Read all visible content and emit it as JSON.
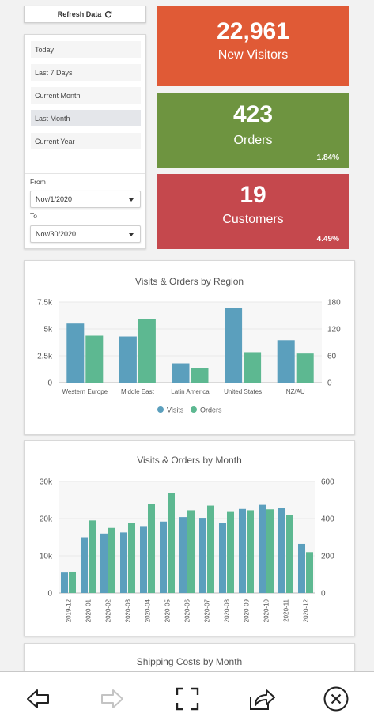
{
  "refresh": {
    "label": "Refresh Data",
    "icon": "refresh-icon"
  },
  "date_ranges": [
    "Today",
    "Last 7 Days",
    "Current Month",
    "Last Month",
    "Current Year"
  ],
  "date_range_selected": "Last Month",
  "from": {
    "label": "From",
    "value": "Nov/1/2020"
  },
  "to": {
    "label": "To",
    "value": "Nov/30/2020"
  },
  "kpis": [
    {
      "value": "22,961",
      "label": "New Visitors",
      "percent": "",
      "color": "#e05a36"
    },
    {
      "value": "423",
      "label": "Orders",
      "percent": "1.84%",
      "color": "#6e9440"
    },
    {
      "value": "19",
      "label": "Customers",
      "percent": "4.49%",
      "color": "#c5484d"
    }
  ],
  "colors": {
    "visits": "#5b9fbd",
    "orders": "#5db891"
  },
  "chart_data": [
    {
      "type": "bar",
      "title": "Visits & Orders by Region",
      "categories": [
        "Western Europe",
        "Middle East",
        "Latin America",
        "United States",
        "NZ/AU"
      ],
      "series": [
        {
          "name": "Visits",
          "axis": "left",
          "values": [
            5500,
            4300,
            1800,
            6950,
            3950
          ]
        },
        {
          "name": "Orders",
          "axis": "right",
          "values": [
            105,
            142,
            33,
            68,
            65
          ]
        }
      ],
      "ylim_left": [
        0,
        7500
      ],
      "yticks_left": [
        "0",
        "2.5k",
        "5k",
        "7.5k"
      ],
      "ylim_right": [
        0,
        180
      ],
      "yticks_right": [
        "0",
        "60",
        "120",
        "180"
      ],
      "legend": "bottom",
      "grid": true
    },
    {
      "type": "bar",
      "title": "Visits & Orders by Month",
      "categories": [
        "2019-12",
        "2020-01",
        "2020-02",
        "2020-03",
        "2020-04",
        "2020-05",
        "2020-06",
        "2020-07",
        "2020-08",
        "2020-09",
        "2020-10",
        "2020-11",
        "2020-12"
      ],
      "series": [
        {
          "name": "Visits",
          "axis": "left",
          "values": [
            5500,
            15000,
            16000,
            16300,
            18000,
            19200,
            20400,
            20200,
            18800,
            22600,
            23700,
            22800,
            13200
          ]
        },
        {
          "name": "Orders",
          "axis": "right",
          "values": [
            115,
            390,
            350,
            375,
            480,
            540,
            445,
            470,
            440,
            445,
            450,
            420,
            220
          ]
        }
      ],
      "ylim_left": [
        0,
        30000
      ],
      "yticks_left": [
        "0",
        "10k",
        "20k",
        "30k"
      ],
      "ylim_right": [
        0,
        600
      ],
      "yticks_right": [
        "0",
        "200",
        "400",
        "600"
      ],
      "legend": "none",
      "grid": true
    }
  ],
  "third_chart_title": "Shipping Costs by Month",
  "toolbar": [
    {
      "name": "back-button",
      "icon": "back-arrow-icon",
      "enabled": true
    },
    {
      "name": "forward-button",
      "icon": "forward-arrow-icon",
      "enabled": false
    },
    {
      "name": "fullscreen-button",
      "icon": "fullscreen-icon",
      "enabled": true
    },
    {
      "name": "share-button",
      "icon": "share-icon",
      "enabled": true
    },
    {
      "name": "close-button",
      "icon": "close-icon",
      "enabled": true
    }
  ]
}
